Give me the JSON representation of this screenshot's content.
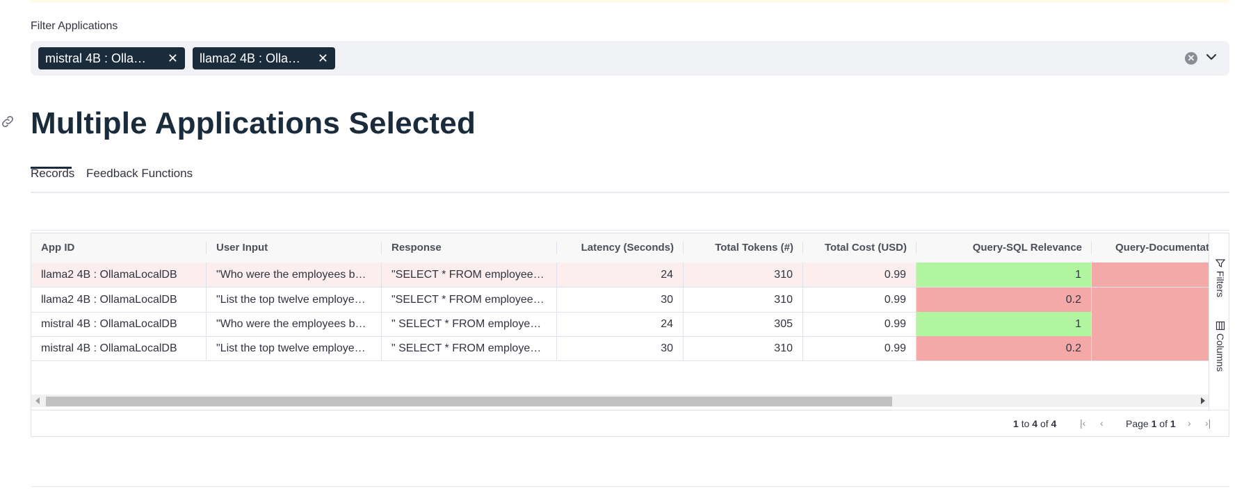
{
  "filter": {
    "label": "Filter Applications",
    "chips": [
      "mistral 4B : Olla…",
      "llama2 4B : Olla…"
    ]
  },
  "page_title": "Multiple Applications Selected",
  "tabs": [
    "Records",
    "Feedback Functions"
  ],
  "grid": {
    "headers": [
      "App ID",
      "User Input",
      "Response",
      "Latency (Seconds)",
      "Total Tokens (#)",
      "Total Cost (USD)",
      "Query-SQL Relevance",
      "Query-Documentatio"
    ],
    "rows": [
      {
        "app_id": "llama2 4B : OllamaLocalDB",
        "user_input": "\"Who were the employees b…",
        "response": "\"SELECT * FROM employees …",
        "latency": "24",
        "tokens": "310",
        "cost": "0.99",
        "qsql": "1",
        "qdoc": ""
      },
      {
        "app_id": "llama2 4B : OllamaLocalDB",
        "user_input": "\"List the top twelve employe…",
        "response": "\"SELECT * FROM employees …",
        "latency": "30",
        "tokens": "310",
        "cost": "0.99",
        "qsql": "0.2",
        "qdoc": ""
      },
      {
        "app_id": "mistral 4B : OllamaLocalDB",
        "user_input": "\"Who were the employees b…",
        "response": "\" SELECT * FROM employees…",
        "latency": "24",
        "tokens": "305",
        "cost": "0.99",
        "qsql": "1",
        "qdoc": ""
      },
      {
        "app_id": "mistral 4B : OllamaLocalDB",
        "user_input": "\"List the top twelve employe…",
        "response": "\" SELECT * FROM employees…",
        "latency": "30",
        "tokens": "310",
        "cost": "0.99",
        "qsql": "0.2",
        "qdoc": ""
      }
    ],
    "side_panel": {
      "filters": "Filters",
      "columns": "Columns"
    },
    "pager": {
      "from": "1",
      "to_word": "to",
      "to": "4",
      "of_word": "of",
      "total": "4",
      "page_word": "Page",
      "page": "1",
      "page_of": "of",
      "pages": "1"
    }
  },
  "colors": {
    "good": "#b1f5a0",
    "bad": "#f5a8a8",
    "highlight_row": "#fceeee",
    "title": "#1a2b3c"
  }
}
